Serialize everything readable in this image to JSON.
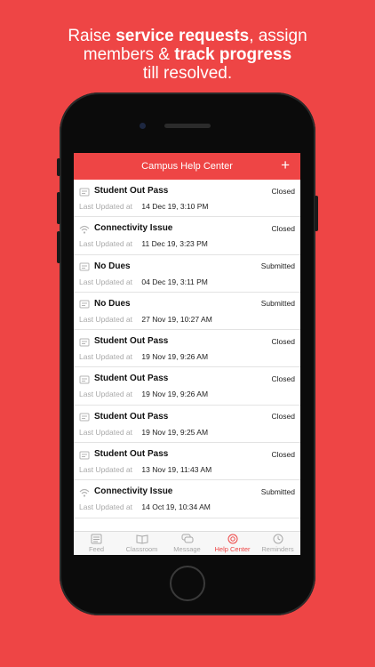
{
  "headline": {
    "part1": "Raise ",
    "bold1": "service requests",
    "part2": ", assign",
    "part3": "members & ",
    "bold2": "track progress",
    "part4": "till resolved."
  },
  "app": {
    "title": "Campus Help Center",
    "add_label": "+"
  },
  "last_updated_label": "Last Updated at",
  "requests": [
    {
      "icon": "document-icon",
      "title": "Student Out Pass",
      "status": "Closed",
      "updated": "14 Dec 19, 3:10 PM"
    },
    {
      "icon": "wifi-icon",
      "title": "Connectivity Issue",
      "status": "Closed",
      "updated": "11 Dec 19, 3:23 PM"
    },
    {
      "icon": "document-icon",
      "title": "No Dues",
      "status": "Submitted",
      "updated": "04 Dec 19, 3:11 PM"
    },
    {
      "icon": "document-icon",
      "title": "No Dues",
      "status": "Submitted",
      "updated": "27 Nov 19, 10:27 AM"
    },
    {
      "icon": "document-icon",
      "title": "Student Out Pass",
      "status": "Closed",
      "updated": "19 Nov 19, 9:26 AM"
    },
    {
      "icon": "document-icon",
      "title": "Student Out Pass",
      "status": "Closed",
      "updated": "19 Nov 19, 9:26 AM"
    },
    {
      "icon": "document-icon",
      "title": "Student Out Pass",
      "status": "Closed",
      "updated": "19 Nov 19, 9:25 AM"
    },
    {
      "icon": "document-icon",
      "title": "Student Out Pass",
      "status": "Closed",
      "updated": "13 Nov 19, 11:43 AM"
    },
    {
      "icon": "wifi-icon",
      "title": "Connectivity Issue",
      "status": "Submitted",
      "updated": "14 Oct 19, 10:34 AM"
    }
  ],
  "tabs": [
    {
      "label": "Feed",
      "icon": "feed-icon",
      "active": false
    },
    {
      "label": "Classroom",
      "icon": "book-icon",
      "active": false
    },
    {
      "label": "Message",
      "icon": "chat-icon",
      "active": false
    },
    {
      "label": "Help Center",
      "icon": "lifebuoy-icon",
      "active": true
    },
    {
      "label": "Reminders",
      "icon": "clock-icon",
      "active": false
    }
  ],
  "colors": {
    "accent": "#ee4545",
    "inactive": "#a8a8a8"
  }
}
